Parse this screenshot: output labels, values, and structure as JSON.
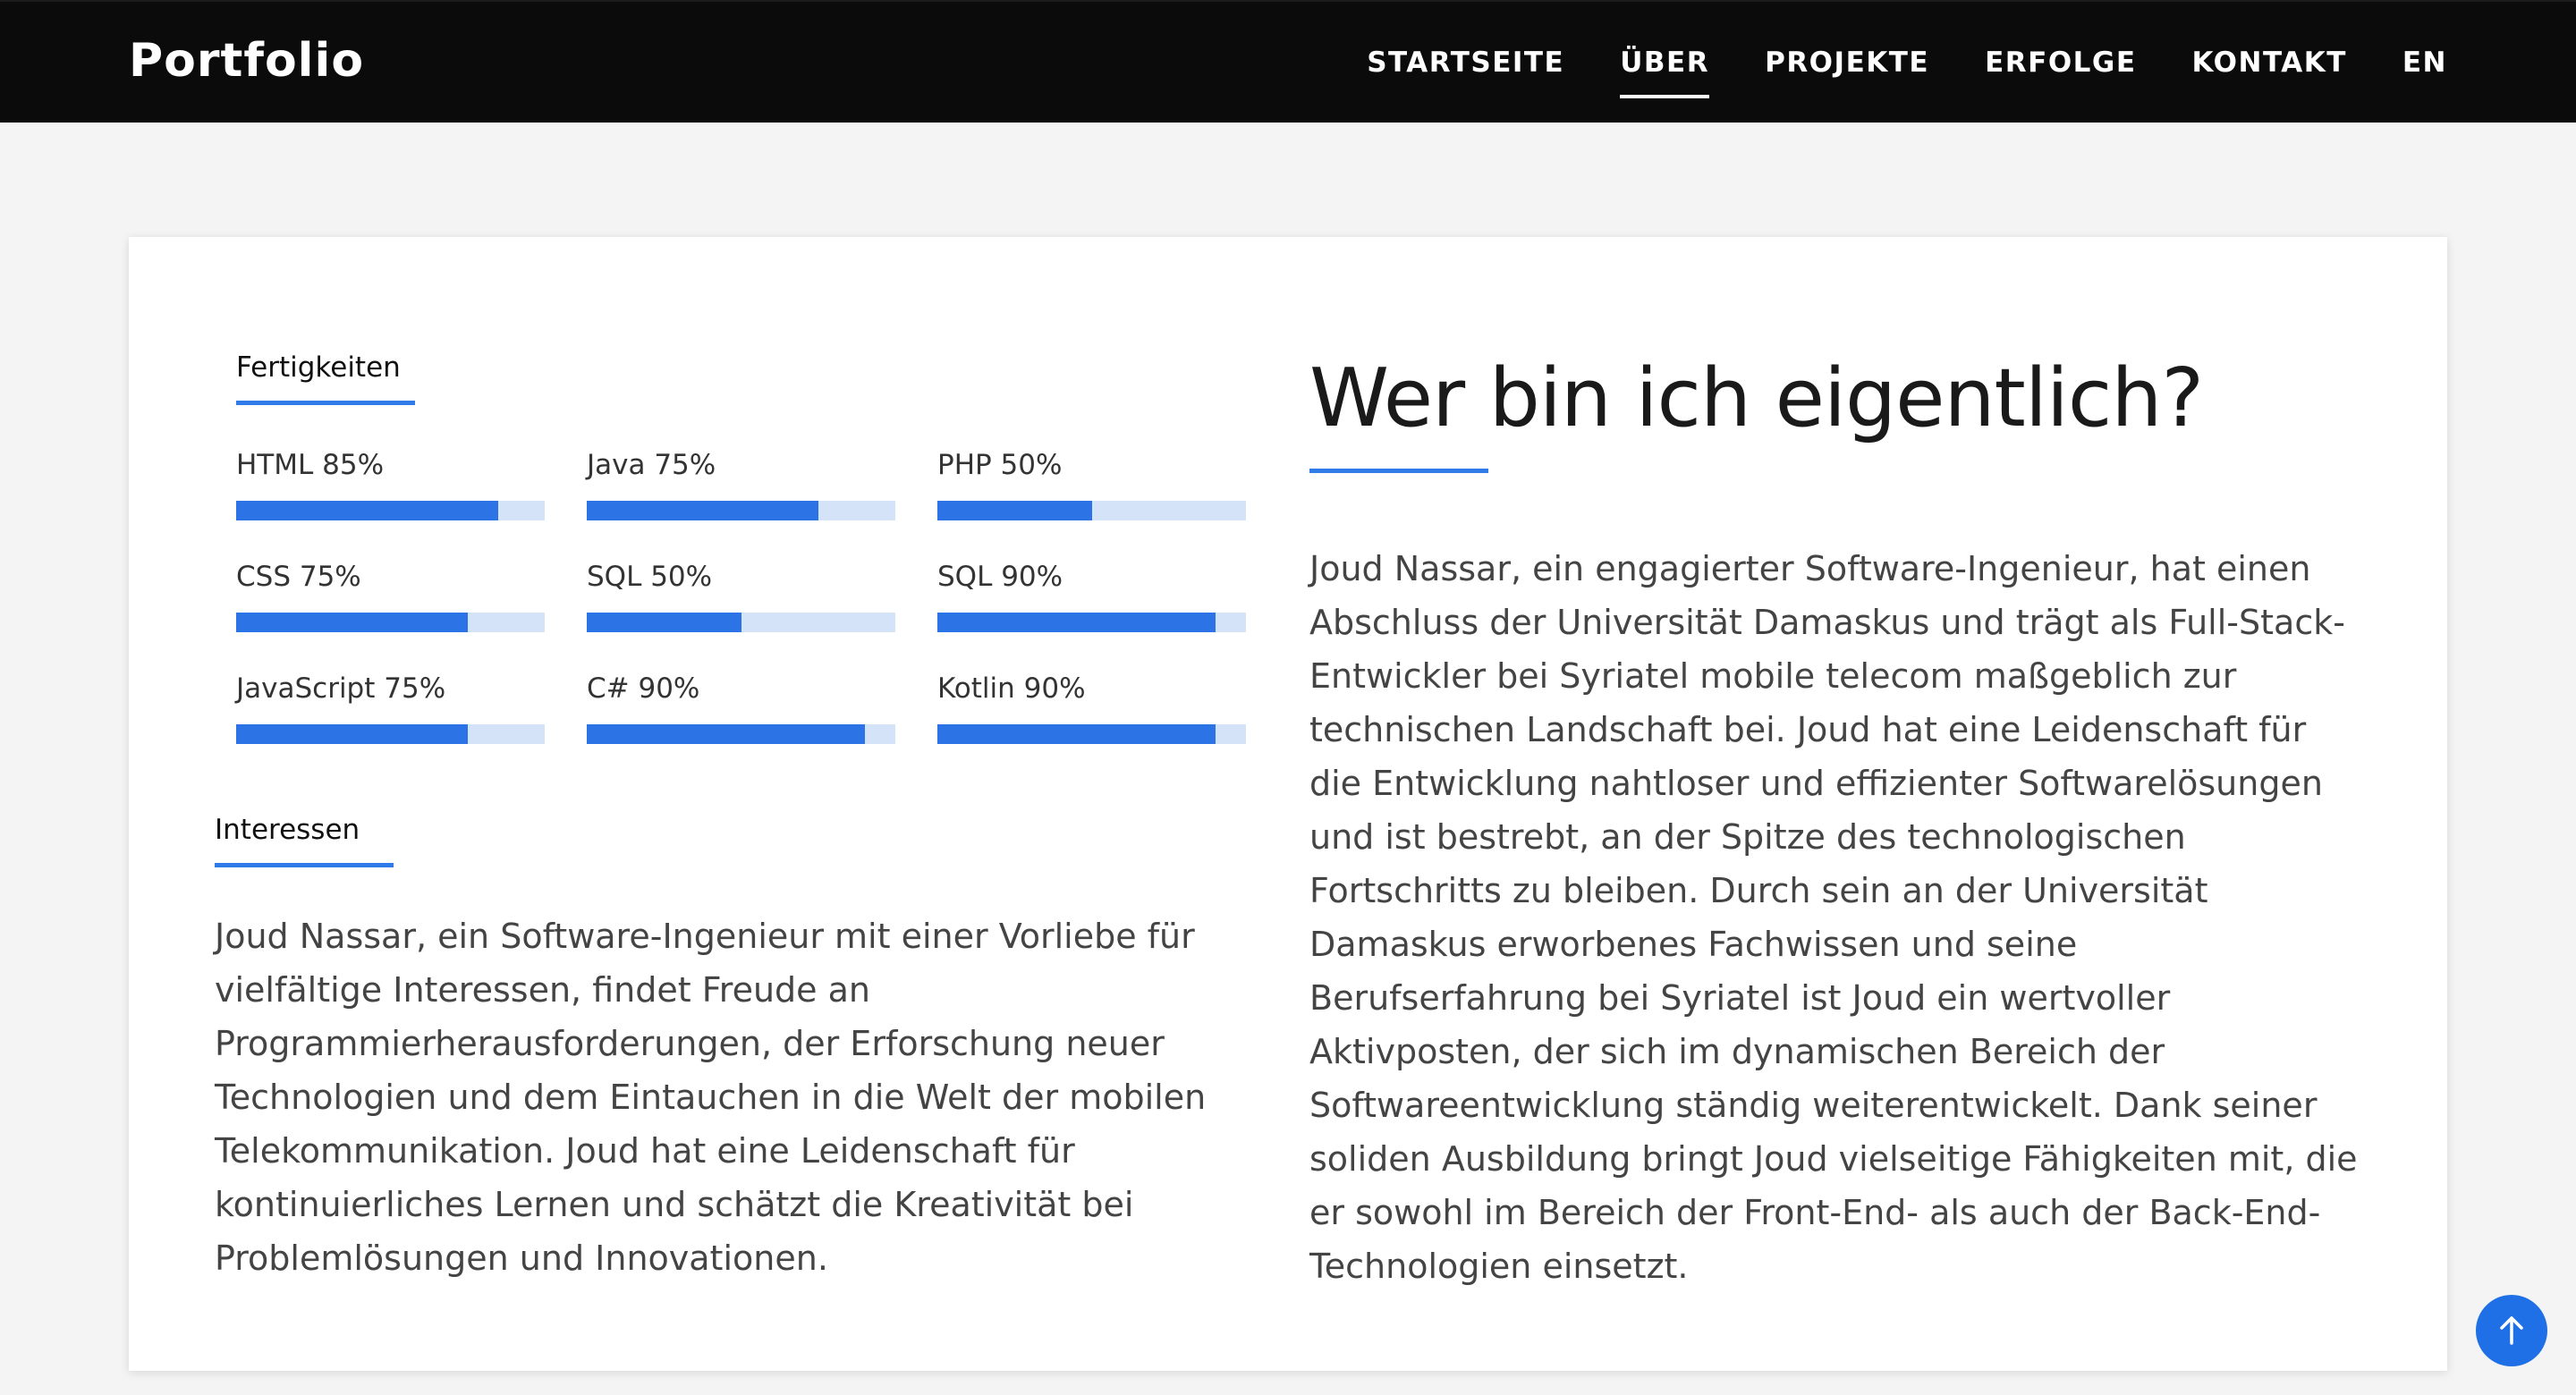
{
  "header": {
    "brand": "Portfolio",
    "nav": [
      {
        "label": "STARTSEITE",
        "active": false
      },
      {
        "label": "ÜBER",
        "active": true
      },
      {
        "label": "PROJEKTE",
        "active": false
      },
      {
        "label": "ERFOLGE",
        "active": false
      },
      {
        "label": "KONTAKT",
        "active": false
      },
      {
        "label": "EN",
        "active": false
      }
    ]
  },
  "skills": {
    "heading": "Fertigkeiten",
    "items": [
      {
        "label": "HTML 85%",
        "level": 0.85
      },
      {
        "label": "Java 75%",
        "level": 0.75
      },
      {
        "label": "PHP 50%",
        "level": 0.5
      },
      {
        "label": "CSS 75%",
        "level": 0.75
      },
      {
        "label": "SQL 50%",
        "level": 0.5
      },
      {
        "label": "SQL 90%",
        "level": 0.9
      },
      {
        "label": "JavaScript 75%",
        "level": 0.75
      },
      {
        "label": "C# 90%",
        "level": 0.9
      },
      {
        "label": "Kotlin 90%",
        "level": 0.9
      }
    ]
  },
  "interests": {
    "heading": "Interessen",
    "text": "Joud Nassar, ein Software-Ingenieur mit einer Vorliebe für vielfältige Interessen, findet Freude an Programmierherausforderungen, der Erforschung neuer Technologien und dem Eintauchen in die Welt der mobilen Telekommunikation. Joud hat eine Leidenschaft für kontinuierliches Lernen und schätzt die Kreativität bei Problemlösungen und Innovationen."
  },
  "about": {
    "title": "Wer bin ich eigentlich?",
    "text": "Joud Nassar, ein engagierter Software-Ingenieur, hat einen Abschluss der Universität Damaskus und trägt als Full-Stack-Entwickler bei Syriatel mobile telecom maßgeblich zur technischen Landschaft bei. Joud hat eine Leidenschaft für die Entwicklung nahtloser und effizienter Softwarelösungen und ist bestrebt, an der Spitze des technologischen Fortschritts zu bleiben. Durch sein an der Universität Damaskus erworbenes Fachwissen und seine Berufserfahrung bei Syriatel ist Joud ein wertvoller Aktivposten, der sich im dynamischen Bereich der Softwareentwicklung ständig weiterentwickelt. Dank seiner soliden Ausbildung bringt Joud vielseitige Fähigkeiten mit, die er sowohl im Bereich der Front-End- als auch der Back-End-Technologien einsetzt."
  },
  "scroll_top": {
    "icon": "arrow-up-icon"
  },
  "colors": {
    "accent": "#2c73e6",
    "track": "#d4e3f8",
    "header_bg": "#0b0b0b"
  }
}
